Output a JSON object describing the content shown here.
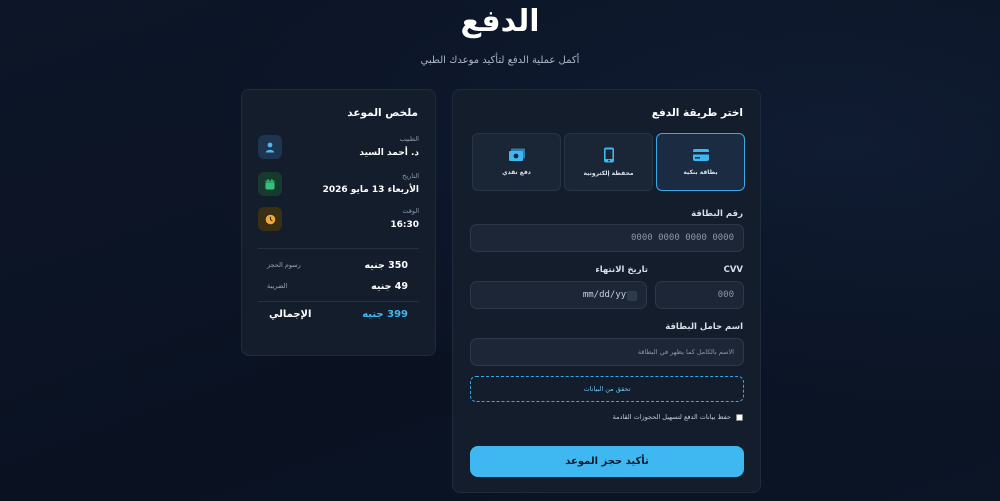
{
  "page": {
    "title": "الدفع",
    "subtitle": "أكمل عملية الدفع لتأكيد موعدك الطبي"
  },
  "payment": {
    "heading": "اختر طريقة الدفع",
    "methods": [
      {
        "label": "بطاقة بنكية",
        "icon": "credit-card-icon",
        "active": true
      },
      {
        "label": "محفظة إلكترونية",
        "icon": "mobile-wallet-icon",
        "active": false
      },
      {
        "label": "دفع نقدي",
        "icon": "cash-icon",
        "active": false
      }
    ],
    "card_number_label": "رقم البطاقة",
    "card_number_placeholder": "0000 0000 0000 0000",
    "expiry_label": "تاريخ الانتهاء",
    "expiry_placeholder": "mm/dd/yyyy",
    "cvv_label": "CVV",
    "cvv_placeholder": "000",
    "holder_label": "اسم حامل البطاقة",
    "holder_placeholder": "الاسم بالكامل كما يظهر في البطاقة",
    "verify_label": "تحقق من البيانات",
    "save_label": "حفظ بيانات الدفع لتسهيل الحجوزات القادمة",
    "confirm_label": "تأكيد حجز الموعد"
  },
  "summary": {
    "title": "ملخص الموعد",
    "doctor_label": "الطبيب",
    "doctor_value": "د. أحمد السيد",
    "date_label": "التاريخ",
    "date_value": "الأربعاء 13 مايو 2026",
    "time_label": "الوقت",
    "time_value": "16:30",
    "fee_label": "رسوم الحجز",
    "fee_value": "350 جنيه",
    "tax_label": "الضريبة",
    "tax_value": "49 جنيه",
    "total_label": "الإجمالي",
    "total_value": "399 جنيه"
  },
  "colors": {
    "accent": "#3fb8f2",
    "background": "#0b1424",
    "panel": "#131d2c",
    "user_icon_bg": "#1d3550",
    "calendar_icon_bg": "#173a2e",
    "clock_icon_bg": "#3a2f14"
  }
}
